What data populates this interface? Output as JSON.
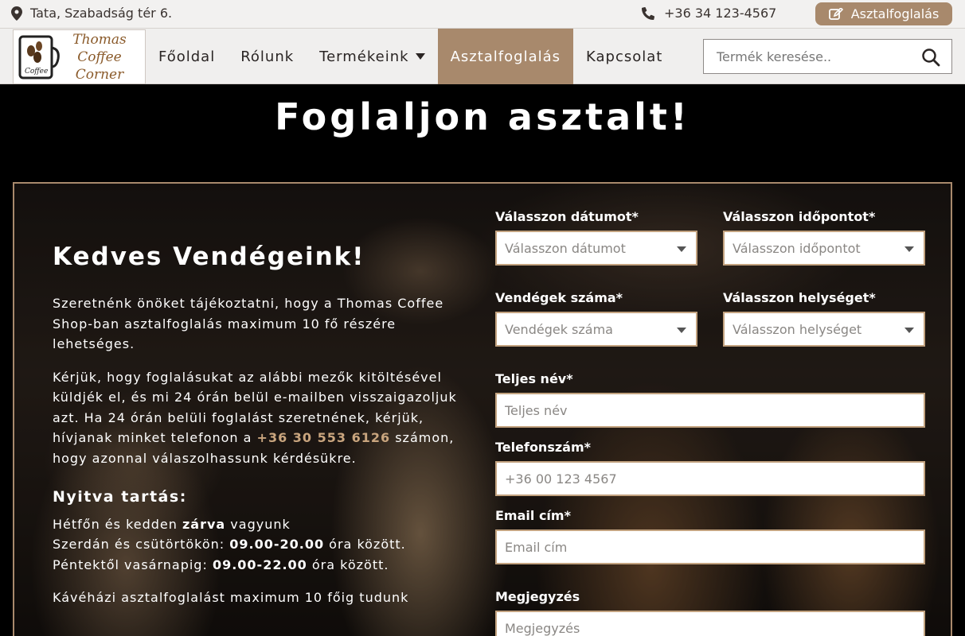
{
  "topbar": {
    "address": "Tata, Szabadság tér 6.",
    "phone": "+36 34 123-4567",
    "booking_button": "Asztalfoglalás"
  },
  "logo": {
    "line1": "Thomas Coffee",
    "line2": "Corner",
    "cup_label": "Coffee"
  },
  "nav": {
    "items": [
      {
        "label": "Főoldal"
      },
      {
        "label": "Rólunk"
      },
      {
        "label": "Termékeink"
      },
      {
        "label": "Asztalfoglalás"
      },
      {
        "label": "Kapcsolat"
      }
    ],
    "active_index": 3,
    "search_placeholder": "Termék keresése.."
  },
  "hero": {
    "title": "Foglaljon asztalt!"
  },
  "welcome": {
    "heading": "Kedves Vendégeink!",
    "para1": "Szeretnénk önöket tájékoztatni, hogy a Thomas Coffee Shop-ban asztalfoglalás maximum 10 fő részére lehetséges.",
    "para2_a": "Kérjük, hogy foglalásukat az alábbi mezők kitöltésével küldjék el, és mi 24 órán belül e-mailben visszaigazoljuk azt. Ha 24 órán belüli foglalást szeretnének, kérjük, hívjanak minket telefonon a ",
    "para2_phone": "+36 30 553 6126",
    "para2_b": " számon, hogy azonnal válaszolhassunk kérdésükre.",
    "hours_heading": "Nyitva tartás:",
    "hours_line1_a": "Hétfőn és kedden ",
    "hours_line1_b": "zárva",
    "hours_line1_c": " vagyunk",
    "hours_line2_a": "Szerdán és csütörtökön: ",
    "hours_line2_b": "09.00-20.00",
    "hours_line2_c": " óra között.",
    "hours_line3_a": "Péntektől vasárnapig: ",
    "hours_line3_b": "09.00-22.00",
    "hours_line3_c": " óra között.",
    "para4": "Kávéházi asztalfoglalást maximum 10 főig tudunk"
  },
  "form": {
    "date": {
      "label": "Válasszon dátumot*",
      "placeholder": "Válasszon dátumot"
    },
    "time": {
      "label": "Válasszon időpontot*",
      "placeholder": "Válasszon időpontot"
    },
    "guests": {
      "label": "Vendégek száma*",
      "placeholder": "Vendégek száma"
    },
    "place": {
      "label": "Válasszon helységet*",
      "placeholder": "Válasszon helységet"
    },
    "name": {
      "label": "Teljes név*",
      "placeholder": "Teljes név"
    },
    "phone": {
      "label": "Telefonszám*",
      "placeholder": "+36 00 123 4567"
    },
    "email": {
      "label": "Email cím*",
      "placeholder": "Email cím"
    },
    "note": {
      "label": "Megjegyzés",
      "placeholder": "Megjegyzés"
    }
  },
  "colors": {
    "accent": "#a8896c",
    "field_border": "#c2a27f",
    "link_gold": "#c9a57e"
  }
}
